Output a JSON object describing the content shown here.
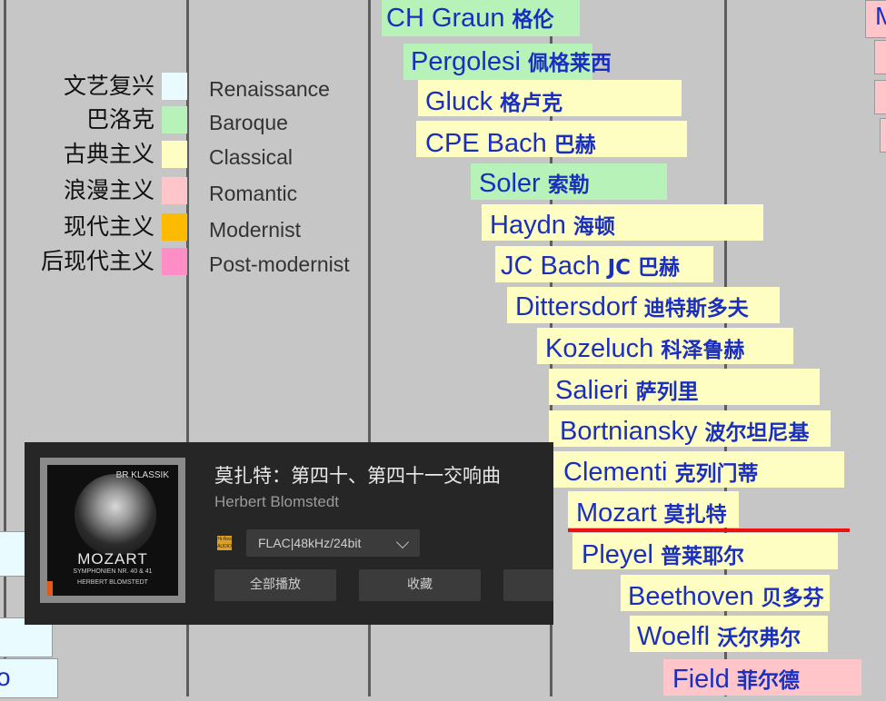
{
  "legend": [
    {
      "zh": "文艺复兴",
      "en": "Renaissance",
      "color": "#e9fbff"
    },
    {
      "zh": "巴洛克",
      "en": "Baroque",
      "color": "#b7f3b9"
    },
    {
      "zh": "古典主义",
      "en": "Classical",
      "color": "#fefec3"
    },
    {
      "zh": "浪漫主义",
      "en": "Romantic",
      "color": "#ffc5c8"
    },
    {
      "zh": "现代主义",
      "en": "Modernist",
      "color": "#fdbb00"
    },
    {
      "zh": "后现代主义",
      "en": "Post-modernist",
      "color": "#ff8ec7"
    }
  ],
  "composers": [
    {
      "en": "CH Graun",
      "zh": "格伦",
      "era": "baroque"
    },
    {
      "en": "Pergolesi",
      "zh": "佩格莱西",
      "era": "baroque"
    },
    {
      "en": "Gluck",
      "zh": "格卢克",
      "era": "classical"
    },
    {
      "en": "CPE Bach",
      "zh": "巴赫",
      "era": "classical"
    },
    {
      "en": "Soler",
      "zh": "索勒",
      "era": "baroque"
    },
    {
      "en": "Haydn",
      "zh": "海顿",
      "era": "classical"
    },
    {
      "en": "JC Bach",
      "zh": "JC 巴赫",
      "era": "classical"
    },
    {
      "en": "Dittersdorf",
      "zh": "迪特斯多夫",
      "era": "classical"
    },
    {
      "en": "Kozeluch",
      "zh": "科泽鲁赫",
      "era": "classical"
    },
    {
      "en": "Salieri",
      "zh": "萨列里",
      "era": "classical"
    },
    {
      "en": "Bortniansky",
      "zh": "波尔坦尼基",
      "era": "classical"
    },
    {
      "en": "Clementi",
      "zh": "克列门蒂",
      "era": "classical"
    },
    {
      "en": "Mozart",
      "zh": "莫扎特",
      "era": "classical",
      "highlighted": true
    },
    {
      "en": "Pleyel",
      "zh": "普莱耶尔",
      "era": "classical"
    },
    {
      "en": "Beethoven",
      "zh": "贝多芬",
      "era": "classical"
    },
    {
      "en": "Woelfl",
      "zh": "沃尔弗尔",
      "era": "classical"
    },
    {
      "en": "Field",
      "zh": "菲尔德",
      "era": "romantic"
    }
  ],
  "edge_labels": {
    "top_right": "M",
    "bottom_left": "o"
  },
  "highlight_color": "#ee1111",
  "player": {
    "album_title": "莫扎特：第四十、第四十一交响曲",
    "artist": "Herbert Blomstedt",
    "format": "FLAC|48kHz/24bit",
    "hires_badge": "Hi-Res AUDIO",
    "buttons": {
      "play_all": "全部播放",
      "favorite": "收藏"
    },
    "cover": {
      "label": "BR KLASSIK",
      "title": "MOZART",
      "subtitle": "SYMPHONIEN NR. 40 & 41",
      "conductor": "HERBERT BLOMSTEDT"
    }
  }
}
